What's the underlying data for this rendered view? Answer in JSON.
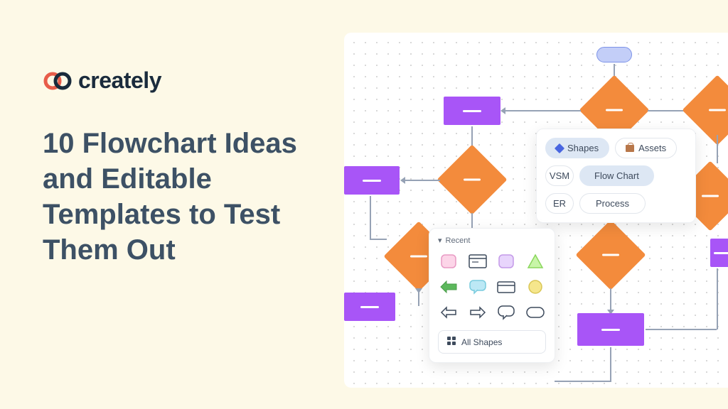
{
  "brand": "creately",
  "title": "10 Flowchart Ideas and Editable Templates to Test Them Out",
  "panels": {
    "tabs": {
      "shapes": "Shapes",
      "assets": "Assets"
    },
    "categories": {
      "vsm": "VSM",
      "flowchart": "Flow Chart",
      "er": "ER",
      "process": "Process"
    },
    "recent_label": "Recent",
    "all_shapes": "All Shapes"
  },
  "shape_icons": [
    "rounded-pink",
    "card",
    "rounded-purple",
    "triangle",
    "arrow-left-green",
    "speech-bubble",
    "card-alt",
    "circle-yellow",
    "arrow-left-outline",
    "arrow-right-outline",
    "speech-outline",
    "pill-outline"
  ],
  "colors": {
    "process": "#a855f7",
    "decision": "#f38b3c",
    "start": "#c3cef8",
    "connector": "#96a2b5"
  }
}
